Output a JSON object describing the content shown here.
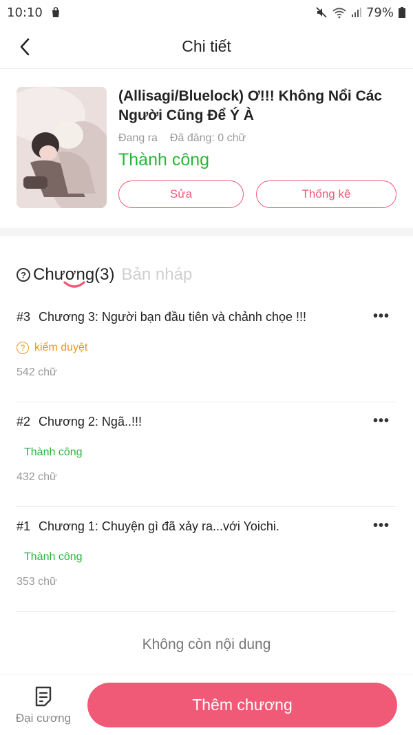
{
  "status_bar": {
    "time": "10:10",
    "battery": "79%"
  },
  "header": {
    "title": "Chi tiết"
  },
  "story": {
    "title": "(Allisagi/Bluelock) Ơ!!! Không Nổi Các Người Cũng Để Ý À",
    "state": "Đang ra",
    "published": "Đã đăng: 0 chữ",
    "status": "Thành công",
    "edit_label": "Sửa",
    "stats_label": "Thống kê"
  },
  "tabs": {
    "chapters_label": "Chương(3)",
    "drafts_label": "Bản nháp"
  },
  "chapters": [
    {
      "number": "#3",
      "title": "Chương 3: Người bạn đầu tiên và chảnh chọe !!!",
      "status": "kiểm duyệt",
      "words": "542 chữ"
    },
    {
      "number": "#2",
      "title": "Chương 2: Ngã..!!!",
      "status": "Thành công",
      "words": "432 chữ"
    },
    {
      "number": "#1",
      "title": "Chương 1: Chuyện gì đã xảy ra...với Yoichi.",
      "status": "Thành công",
      "words": "353 chữ"
    }
  ],
  "end_text": "Không còn nội dung",
  "bottom": {
    "outline_label": "Đại cương",
    "add_label": "Thêm chương"
  },
  "colors": {
    "accent": "#f05a77",
    "success": "#2ab53a",
    "warning": "#e89a18"
  }
}
